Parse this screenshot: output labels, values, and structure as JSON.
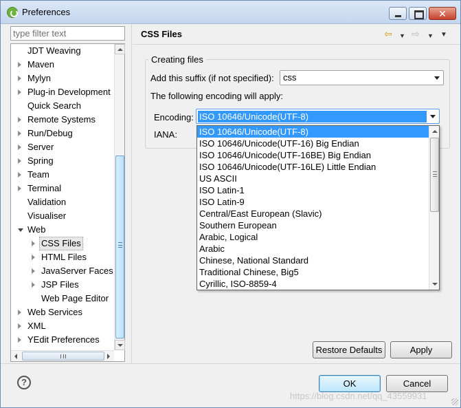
{
  "window": {
    "title": "Preferences"
  },
  "filter": {
    "placeholder": "type filter text"
  },
  "tree": [
    {
      "label": "JDT Weaving",
      "arrow": "none",
      "indent": 0
    },
    {
      "label": "Maven",
      "arrow": "closed",
      "indent": 0
    },
    {
      "label": "Mylyn",
      "arrow": "closed",
      "indent": 0
    },
    {
      "label": "Plug-in Development",
      "arrow": "closed",
      "indent": 0
    },
    {
      "label": "Quick Search",
      "arrow": "none",
      "indent": 0
    },
    {
      "label": "Remote Systems",
      "arrow": "closed",
      "indent": 0
    },
    {
      "label": "Run/Debug",
      "arrow": "closed",
      "indent": 0
    },
    {
      "label": "Server",
      "arrow": "closed",
      "indent": 0
    },
    {
      "label": "Spring",
      "arrow": "closed",
      "indent": 0
    },
    {
      "label": "Team",
      "arrow": "closed",
      "indent": 0
    },
    {
      "label": "Terminal",
      "arrow": "closed",
      "indent": 0
    },
    {
      "label": "Validation",
      "arrow": "none",
      "indent": 0
    },
    {
      "label": "Visualiser",
      "arrow": "none",
      "indent": 0
    },
    {
      "label": "Web",
      "arrow": "open",
      "indent": 0
    },
    {
      "label": "CSS Files",
      "arrow": "closed",
      "indent": 1,
      "selected": true
    },
    {
      "label": "HTML Files",
      "arrow": "closed",
      "indent": 1
    },
    {
      "label": "JavaServer Faces T",
      "arrow": "closed",
      "indent": 1
    },
    {
      "label": "JSP Files",
      "arrow": "closed",
      "indent": 1
    },
    {
      "label": "Web Page Editor",
      "arrow": "none",
      "indent": 1
    },
    {
      "label": "Web Services",
      "arrow": "closed",
      "indent": 0
    },
    {
      "label": "XML",
      "arrow": "closed",
      "indent": 0
    },
    {
      "label": "YEdit Preferences",
      "arrow": "closed",
      "indent": 0
    }
  ],
  "page": {
    "title": "CSS Files",
    "group_title": "Creating files",
    "suffix_label": "Add this suffix (if not specified):",
    "suffix_value": "css",
    "encoding_note": "The following encoding will apply:",
    "encoding_label": "Encoding:",
    "encoding_value": "ISO 10646/Unicode(UTF-8)",
    "iana_label": "IANA:"
  },
  "encoding_options": [
    "ISO 10646/Unicode(UTF-8)",
    "ISO 10646/Unicode(UTF-16) Big Endian",
    "ISO 10646/Unicode(UTF-16BE) Big Endian",
    "ISO 10646/Unicode(UTF-16LE) Little Endian",
    "US ASCII",
    "ISO Latin-1",
    "ISO Latin-9",
    "Central/East European (Slavic)",
    "Southern European",
    "Arabic, Logical",
    "Arabic",
    "Chinese, National Standard",
    "Traditional Chinese, Big5",
    "Cyrillic, ISO-8859-4"
  ],
  "buttons": {
    "restore_defaults": "Restore Defaults",
    "apply": "Apply",
    "ok": "OK",
    "cancel": "Cancel"
  },
  "help_glyph": "?",
  "watermark": "https://blog.csdn.net/qq_43559931"
}
